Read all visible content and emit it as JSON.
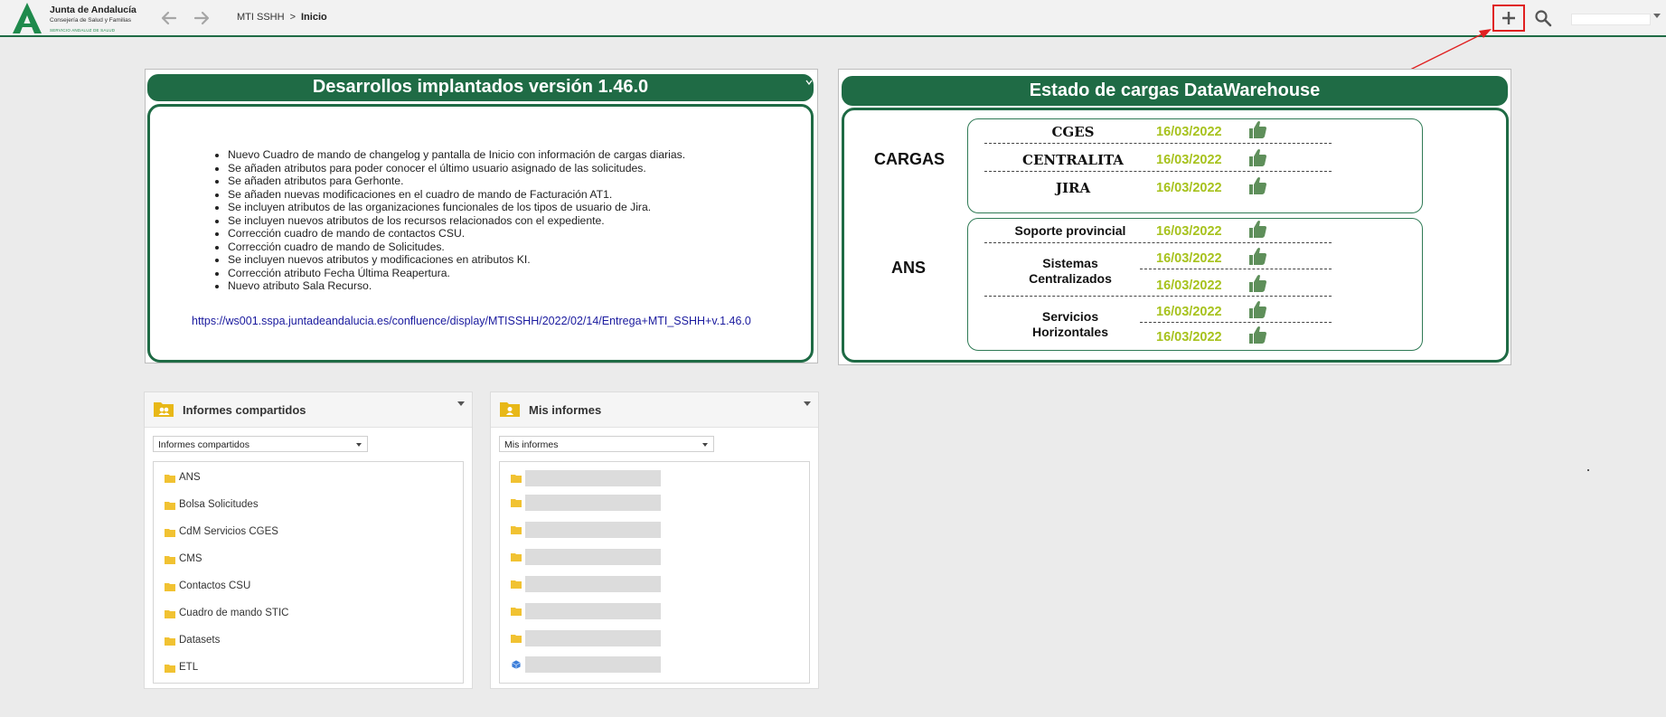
{
  "header": {
    "logo_title": "Junta de Andalucía",
    "logo_subtitle": "Consejería de Salud y Familias",
    "logo_tagline": "SERVICIO ANDALUZ DE SALUD",
    "breadcrumb": {
      "root": "MTI SSHH",
      "separator": ">",
      "current": "Inicio"
    },
    "actions": {
      "back_icon": "arrow-left-icon",
      "forward_icon": "arrow-right-icon",
      "add_icon": "plus-icon",
      "search_icon": "search-icon"
    },
    "user_name": ""
  },
  "developments": {
    "title": "Desarrollos implantados versión 1.46.0",
    "items": [
      "Nuevo Cuadro de mando de changelog y pantalla de Inicio con información de cargas diarias.",
      "Se añaden atributos para poder conocer el último usuario asignado de las solicitudes.",
      "Se añaden atributos para Gerhonte.",
      "Se añaden nuevas modificaciones en el cuadro de mando de Facturación AT1.",
      "Se incluyen atributos de las organizaciones funcionales de los tipos de usuario de Jira.",
      "Se incluyen nuevos atributos de los recursos relacionados con el expediente.",
      "Corrección cuadro de mando de contactos CSU.",
      "Corrección cuadro de mando de Solicitudes.",
      "Se incluyen nuevos atributos y modificaciones en atributos KI.",
      "Corrección atributo Fecha Última Reapertura.",
      "Nuevo atributo Sala Recurso."
    ],
    "link": "https://ws001.sspa.juntadeandalucia.es/confluence/display/MTISSHH/2022/02/14/Entrega+MTI_SSHH+v.1.46.0"
  },
  "datawarehouse": {
    "title": "Estado de cargas DataWarehouse",
    "cargas_label": "CARGAS",
    "ans_label": "ANS",
    "cargas": [
      {
        "name": "CGES",
        "date": "16/03/2022",
        "status_icon": "thumbs-up-icon"
      },
      {
        "name": "CENTRALITA",
        "date": "16/03/2022",
        "status_icon": "thumbs-up-icon"
      },
      {
        "name": "JIRA",
        "date": "16/03/2022",
        "status_icon": "thumbs-up-icon"
      }
    ],
    "ans": [
      {
        "name": "Soporte provincial",
        "dates": [
          "16/03/2022"
        ]
      },
      {
        "name_line1": "Sistemas",
        "name_line2": "Centralizados",
        "dates": [
          "16/03/2022",
          "16/03/2022"
        ]
      },
      {
        "name_line1": "Servicios",
        "name_line2": "Horizontales",
        "dates": [
          "16/03/2022",
          "16/03/2022"
        ]
      }
    ],
    "colors": {
      "header": "#1f6b45",
      "date": "#a7c21d",
      "thumb": "#5e8f5a"
    }
  },
  "shared_reports": {
    "title": "Informes compartidos",
    "select_value": "Informes compartidos",
    "folders": [
      "ANS",
      "Bolsa Solicitudes",
      "CdM Servicios CGES",
      "CMS",
      "Contactos CSU",
      "Cuadro de mando STIC",
      "Datasets",
      "ETL"
    ]
  },
  "my_reports": {
    "title": "Mis informes",
    "select_value": "Mis informes",
    "items": [
      {
        "type": "folder-icon",
        "label": ""
      },
      {
        "type": "folder-icon",
        "label": ""
      },
      {
        "type": "folder-icon",
        "label": ""
      },
      {
        "type": "folder-icon",
        "label": ""
      },
      {
        "type": "folder-icon",
        "label": ""
      },
      {
        "type": "folder-icon",
        "label": ""
      },
      {
        "type": "folder-icon",
        "label": ""
      },
      {
        "type": "cube-icon",
        "label": ""
      }
    ]
  }
}
